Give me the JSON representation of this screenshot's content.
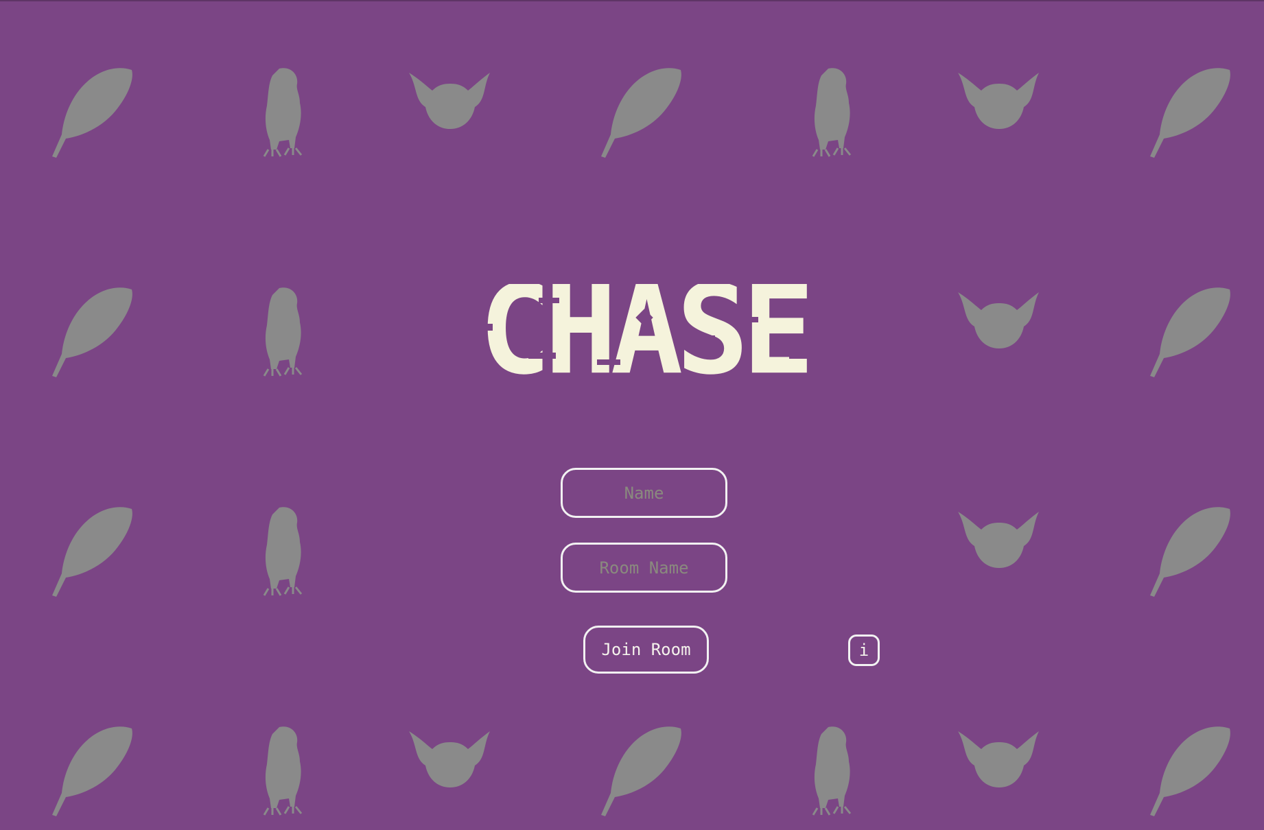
{
  "app": {
    "title": "CHASE"
  },
  "form": {
    "name_placeholder": "Name",
    "name_value": "",
    "room_placeholder": "Room Name",
    "room_value": "",
    "join_label": "Join Room",
    "info_label": "i"
  },
  "background": {
    "icons": [
      "feather-icon",
      "bird-icon",
      "bat-icon"
    ],
    "icon_color": "#8a8a8a"
  },
  "colors": {
    "background": "#7b4585",
    "title": "#f5f3dc",
    "border": "#f2f2f2",
    "placeholder": "#8a8a7e"
  }
}
